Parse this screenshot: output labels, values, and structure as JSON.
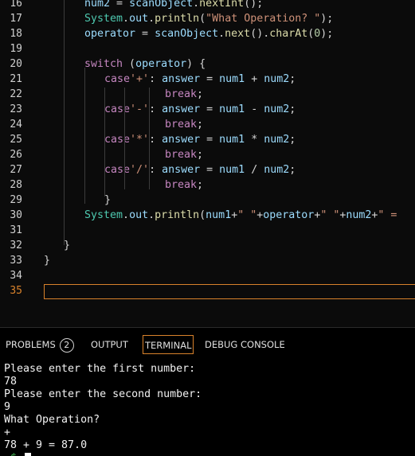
{
  "editor": {
    "lines": [
      {
        "num": "16",
        "tokens": [
          {
            "c": "v",
            "t": "num2"
          },
          {
            "c": "p",
            "t": " = "
          },
          {
            "c": "v",
            "t": "scanObject"
          },
          {
            "c": "p",
            "t": "."
          },
          {
            "c": "f",
            "t": "nextInt"
          },
          {
            "c": "p",
            "t": "();"
          }
        ]
      },
      {
        "num": "17",
        "tokens": [
          {
            "c": "t",
            "t": "System"
          },
          {
            "c": "p",
            "t": "."
          },
          {
            "c": "v",
            "t": "out"
          },
          {
            "c": "p",
            "t": "."
          },
          {
            "c": "f",
            "t": "println"
          },
          {
            "c": "p",
            "t": "("
          },
          {
            "c": "s",
            "t": "\"What Operation? \""
          },
          {
            "c": "p",
            "t": ");"
          }
        ]
      },
      {
        "num": "18",
        "tokens": [
          {
            "c": "v",
            "t": "operator"
          },
          {
            "c": "p",
            "t": " = "
          },
          {
            "c": "v",
            "t": "scanObject"
          },
          {
            "c": "p",
            "t": "."
          },
          {
            "c": "f",
            "t": "next"
          },
          {
            "c": "p",
            "t": "()."
          },
          {
            "c": "f",
            "t": "charAt"
          },
          {
            "c": "p",
            "t": "("
          },
          {
            "c": "n",
            "t": "0"
          },
          {
            "c": "p",
            "t": ");"
          }
        ]
      },
      {
        "num": "19",
        "tokens": []
      },
      {
        "num": "20",
        "tokens": [
          {
            "c": "k",
            "t": "switch"
          },
          {
            "c": "p",
            "t": " ("
          },
          {
            "c": "v",
            "t": "operator"
          },
          {
            "c": "p",
            "t": ") {"
          }
        ]
      },
      {
        "num": "21",
        "tokens": [
          {
            "c": "k",
            "t": "case"
          },
          {
            "c": "s",
            "t": "'+'"
          },
          {
            "c": "p",
            "t": ": "
          },
          {
            "c": "v",
            "t": "answer"
          },
          {
            "c": "p",
            "t": " = "
          },
          {
            "c": "v",
            "t": "num1"
          },
          {
            "c": "p",
            "t": " + "
          },
          {
            "c": "v",
            "t": "num2"
          },
          {
            "c": "p",
            "t": ";"
          }
        ]
      },
      {
        "num": "22",
        "tokens": [
          {
            "c": "k",
            "t": "break"
          },
          {
            "c": "p",
            "t": ";"
          }
        ]
      },
      {
        "num": "23",
        "tokens": [
          {
            "c": "k",
            "t": "case"
          },
          {
            "c": "s",
            "t": "'-'"
          },
          {
            "c": "p",
            "t": ": "
          },
          {
            "c": "v",
            "t": "answer"
          },
          {
            "c": "p",
            "t": " = "
          },
          {
            "c": "v",
            "t": "num1"
          },
          {
            "c": "p",
            "t": " - "
          },
          {
            "c": "v",
            "t": "num2"
          },
          {
            "c": "p",
            "t": ";"
          }
        ]
      },
      {
        "num": "24",
        "tokens": [
          {
            "c": "k",
            "t": "break"
          },
          {
            "c": "p",
            "t": ";"
          }
        ]
      },
      {
        "num": "25",
        "tokens": [
          {
            "c": "k",
            "t": "case"
          },
          {
            "c": "s",
            "t": "'*'"
          },
          {
            "c": "p",
            "t": ": "
          },
          {
            "c": "v",
            "t": "answer"
          },
          {
            "c": "p",
            "t": " = "
          },
          {
            "c": "v",
            "t": "num1"
          },
          {
            "c": "p",
            "t": " * "
          },
          {
            "c": "v",
            "t": "num2"
          },
          {
            "c": "p",
            "t": ";"
          }
        ]
      },
      {
        "num": "26",
        "tokens": [
          {
            "c": "k",
            "t": "break"
          },
          {
            "c": "p",
            "t": ";"
          }
        ]
      },
      {
        "num": "27",
        "tokens": [
          {
            "c": "k",
            "t": "case"
          },
          {
            "c": "s",
            "t": "'/'"
          },
          {
            "c": "p",
            "t": ": "
          },
          {
            "c": "v",
            "t": "answer"
          },
          {
            "c": "p",
            "t": " = "
          },
          {
            "c": "v",
            "t": "num1"
          },
          {
            "c": "p",
            "t": " / "
          },
          {
            "c": "v",
            "t": "num2"
          },
          {
            "c": "p",
            "t": ";"
          }
        ]
      },
      {
        "num": "28",
        "tokens": [
          {
            "c": "k",
            "t": "break"
          },
          {
            "c": "p",
            "t": ";"
          }
        ]
      },
      {
        "num": "29",
        "tokens": [
          {
            "c": "p",
            "t": "}"
          }
        ]
      },
      {
        "num": "30",
        "tokens": [
          {
            "c": "t",
            "t": "System"
          },
          {
            "c": "p",
            "t": "."
          },
          {
            "c": "v",
            "t": "out"
          },
          {
            "c": "p",
            "t": "."
          },
          {
            "c": "f",
            "t": "println"
          },
          {
            "c": "p",
            "t": "("
          },
          {
            "c": "v",
            "t": "num1"
          },
          {
            "c": "p",
            "t": "+"
          },
          {
            "c": "s",
            "t": "\" \""
          },
          {
            "c": "p",
            "t": "+"
          },
          {
            "c": "v",
            "t": "operator"
          },
          {
            "c": "p",
            "t": "+"
          },
          {
            "c": "s",
            "t": "\" \""
          },
          {
            "c": "p",
            "t": "+"
          },
          {
            "c": "v",
            "t": "num2"
          },
          {
            "c": "p",
            "t": "+"
          },
          {
            "c": "s",
            "t": "\" ="
          }
        ]
      },
      {
        "num": "31",
        "tokens": []
      },
      {
        "num": "32",
        "tokens": [
          {
            "c": "p",
            "t": "}"
          }
        ]
      },
      {
        "num": "33",
        "tokens": [
          {
            "c": "p",
            "t": "}"
          }
        ]
      },
      {
        "num": "34",
        "tokens": []
      },
      {
        "num": "35",
        "tokens": []
      }
    ],
    "current_line_color": "#d9822b"
  },
  "panel": {
    "tabs": {
      "problems": "PROBLEMS",
      "problems_count": "2",
      "output": "OUTPUT",
      "terminal": "TERMINAL",
      "debug_console": "DEBUG CONSOLE"
    },
    "active_tab": "TERMINAL"
  },
  "terminal": {
    "lines": [
      "Please enter the first number:",
      "78",
      "Please enter the second number:",
      "9",
      "What Operation?",
      "+",
      "78 + 9 = 87.0"
    ],
    "prompt_tail": "~$ "
  }
}
